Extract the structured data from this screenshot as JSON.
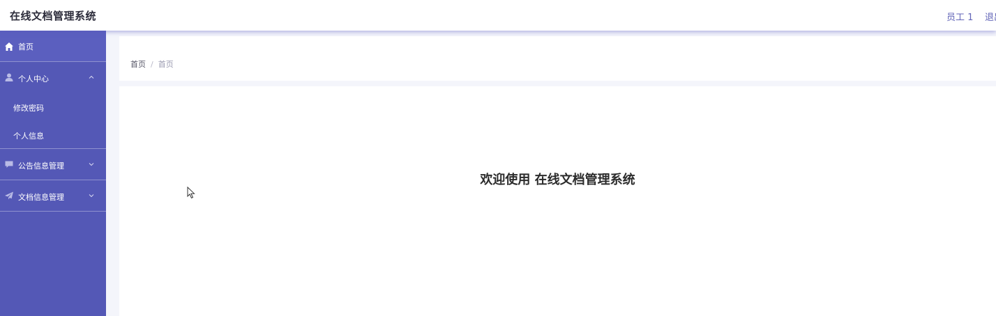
{
  "header": {
    "title": "在线文档管理系统",
    "user": "员工 1",
    "logout": "退出登录"
  },
  "sidebar": {
    "home": {
      "label": "首页",
      "icon": "home-icon"
    },
    "personal_center": {
      "label": "个人中心",
      "icon": "user-icon",
      "expanded": true,
      "children": [
        {
          "label": "修改密码"
        },
        {
          "label": "个人信息"
        }
      ]
    },
    "notice_management": {
      "label": "公告信息管理",
      "icon": "message-icon",
      "expanded": false
    },
    "document_management": {
      "label": "文档信息管理",
      "icon": "paper-plane-icon",
      "expanded": false
    }
  },
  "breadcrumb": {
    "home": "首页",
    "separator": "/",
    "current": "首页"
  },
  "main": {
    "welcome": "欢迎使用 在线文档管理系统"
  },
  "colors": {
    "sidebar_bg": "#5458b6",
    "accent_text": "#6366b8",
    "page_bg": "#f4f5fb"
  }
}
